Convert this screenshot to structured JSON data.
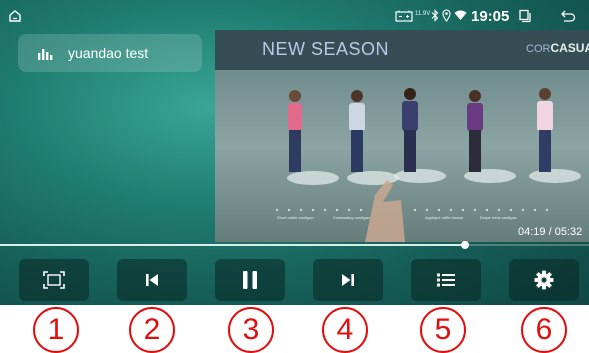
{
  "status_bar": {
    "voltage": "11.9V",
    "time": "19:05"
  },
  "player": {
    "track_title": "yuandao test",
    "progress_fraction": 0.79
  },
  "video": {
    "headline": "NEW SEASON",
    "brand_faint": "COR",
    "brand_strong": "CASUAL",
    "captions": [
      "Short cable cardigan",
      "Contrasting cardigan",
      "Appliqué ruffle blouse",
      "Drape neck cardigan"
    ],
    "time_display": "04:19 / 05:32"
  },
  "controls": {
    "fullscreen": "fullscreen-icon",
    "previous": "skip-previous-icon",
    "pause": "pause-icon",
    "next": "skip-next-icon",
    "playlist": "playlist-icon",
    "settings": "gear-icon"
  },
  "annotations": [
    "1",
    "2",
    "3",
    "4",
    "5",
    "6"
  ],
  "colors": {
    "background": "#1f7d72",
    "button": "#0a2624",
    "annotation": "#e20d0d"
  }
}
